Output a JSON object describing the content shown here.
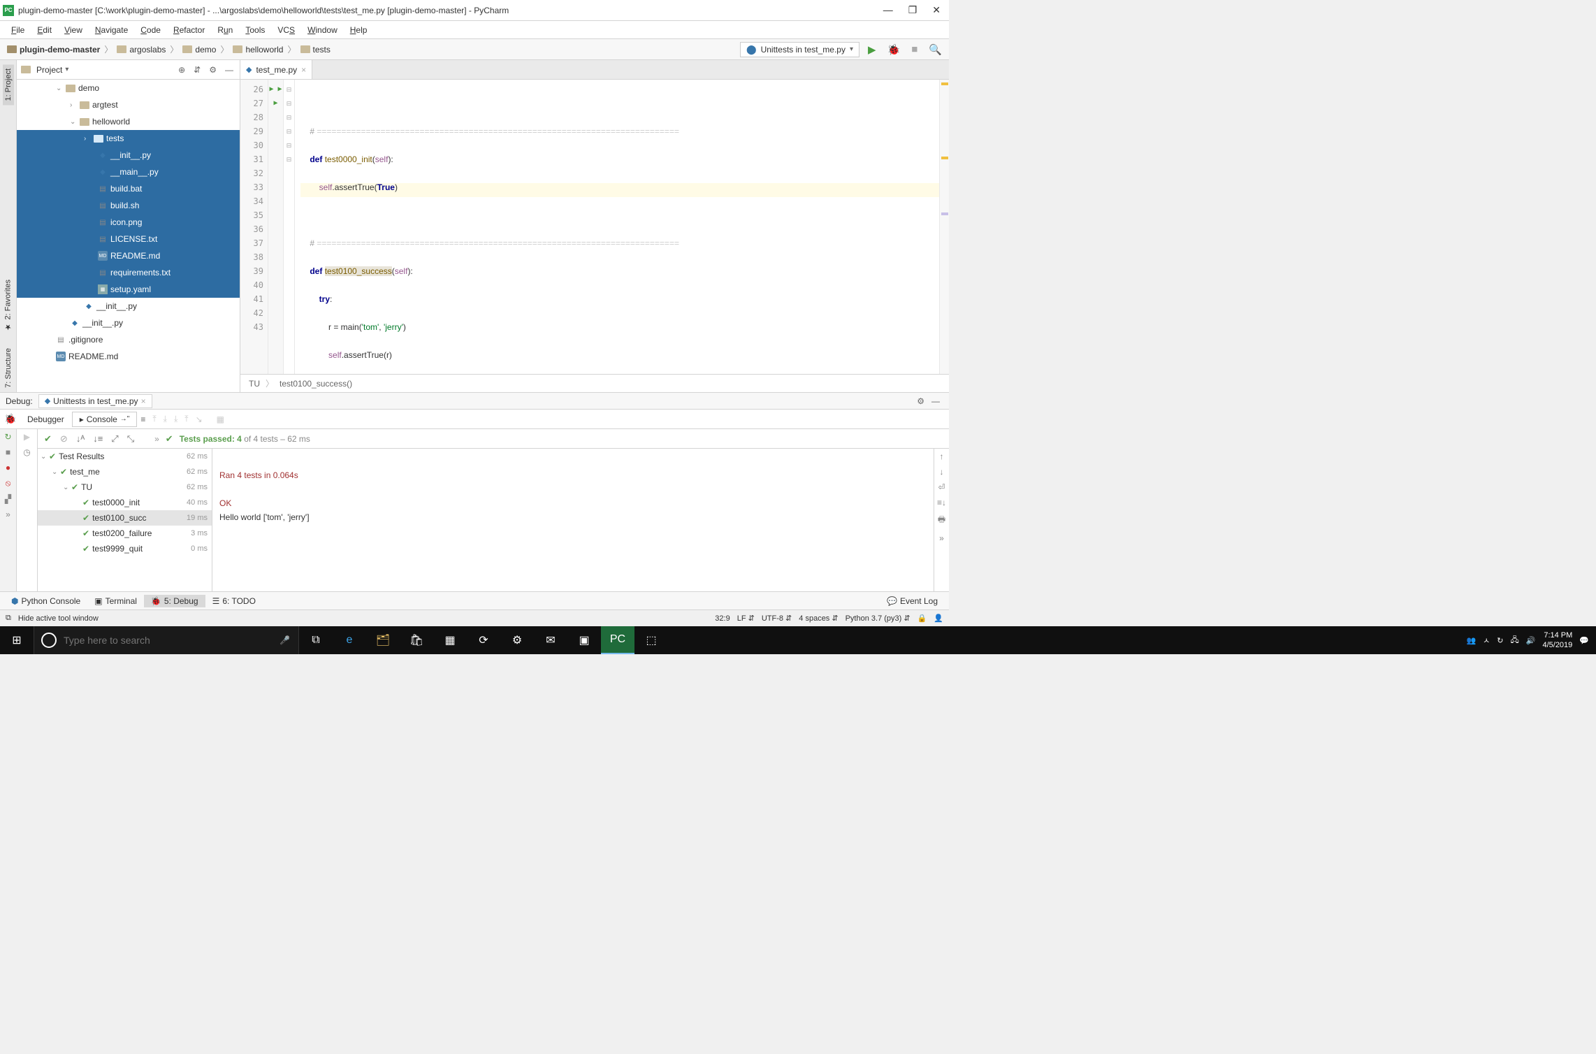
{
  "titlebar": {
    "icon_text": "PC",
    "title": "plugin-demo-master [C:\\work\\plugin-demo-master] - ...\\argoslabs\\demo\\helloworld\\tests\\test_me.py [plugin-demo-master] - PyCharm"
  },
  "menu": [
    "File",
    "Edit",
    "View",
    "Navigate",
    "Code",
    "Refactor",
    "Run",
    "Tools",
    "VCS",
    "Window",
    "Help"
  ],
  "breadcrumb": [
    "plugin-demo-master",
    "argoslabs",
    "demo",
    "helloworld",
    "tests"
  ],
  "run_config": "Unittests in test_me.py",
  "left_tabs": {
    "project": "1: Project",
    "favorites": "2: Favorites",
    "structure": "7: Structure"
  },
  "project_header": "Project",
  "tree": {
    "demo": "demo",
    "argtest": "argtest",
    "helloworld": "helloworld",
    "tests": "tests",
    "init1": "__init__.py",
    "main": "__main__.py",
    "build_bat": "build.bat",
    "build_sh": "build.sh",
    "icon": "icon.png",
    "license": "LICENSE.txt",
    "readme1": "README.md",
    "req": "requirements.txt",
    "setup": "setup.yaml",
    "init2": "__init__.py",
    "init3": "__init__.py",
    "gitignore": ".gitignore",
    "readme2": "README.md"
  },
  "editor_tab": "test_me.py",
  "line_start": 26,
  "line_end": 43,
  "editor_nav": {
    "cls": "TU",
    "fn": "test0100_success()"
  },
  "debug": {
    "label": "Debug:",
    "tab": "Unittests in test_me.py",
    "subtabs": {
      "debugger": "Debugger",
      "console": "Console"
    },
    "tests_pass_prefix": "Tests passed: 4",
    "tests_pass_suffix": " of 4 tests – 62 ms",
    "root": "Test Results",
    "root_t": "62 ms",
    "n1": "test_me",
    "n1_t": "62 ms",
    "n2": "TU",
    "n2_t": "62 ms",
    "l1": "test0000_init",
    "l1_t": "40 ms",
    "l2": "test0100_succ",
    "l2_t": "19 ms",
    "l3": "test0200_failure",
    "l3_t": "3 ms",
    "l4": "test9999_quit",
    "l4_t": "0 ms",
    "console1": "Ran 4 tests in 0.064s",
    "console2": "OK",
    "console3": "Hello world ['tom', 'jerry']"
  },
  "bottom": {
    "python": "Python Console",
    "terminal": "Terminal",
    "debug": "5: Debug",
    "todo": "6: TODO",
    "eventlog": "Event Log"
  },
  "status": {
    "hint": "Hide active tool window",
    "pos": "32:9",
    "le": "LF",
    "enc": "UTF-8",
    "indent": "4 spaces",
    "interp": "Python 3.7 (py3)"
  },
  "taskbar": {
    "search_placeholder": "Type here to search",
    "time": "7:14 PM",
    "date": "4/5/2019"
  }
}
